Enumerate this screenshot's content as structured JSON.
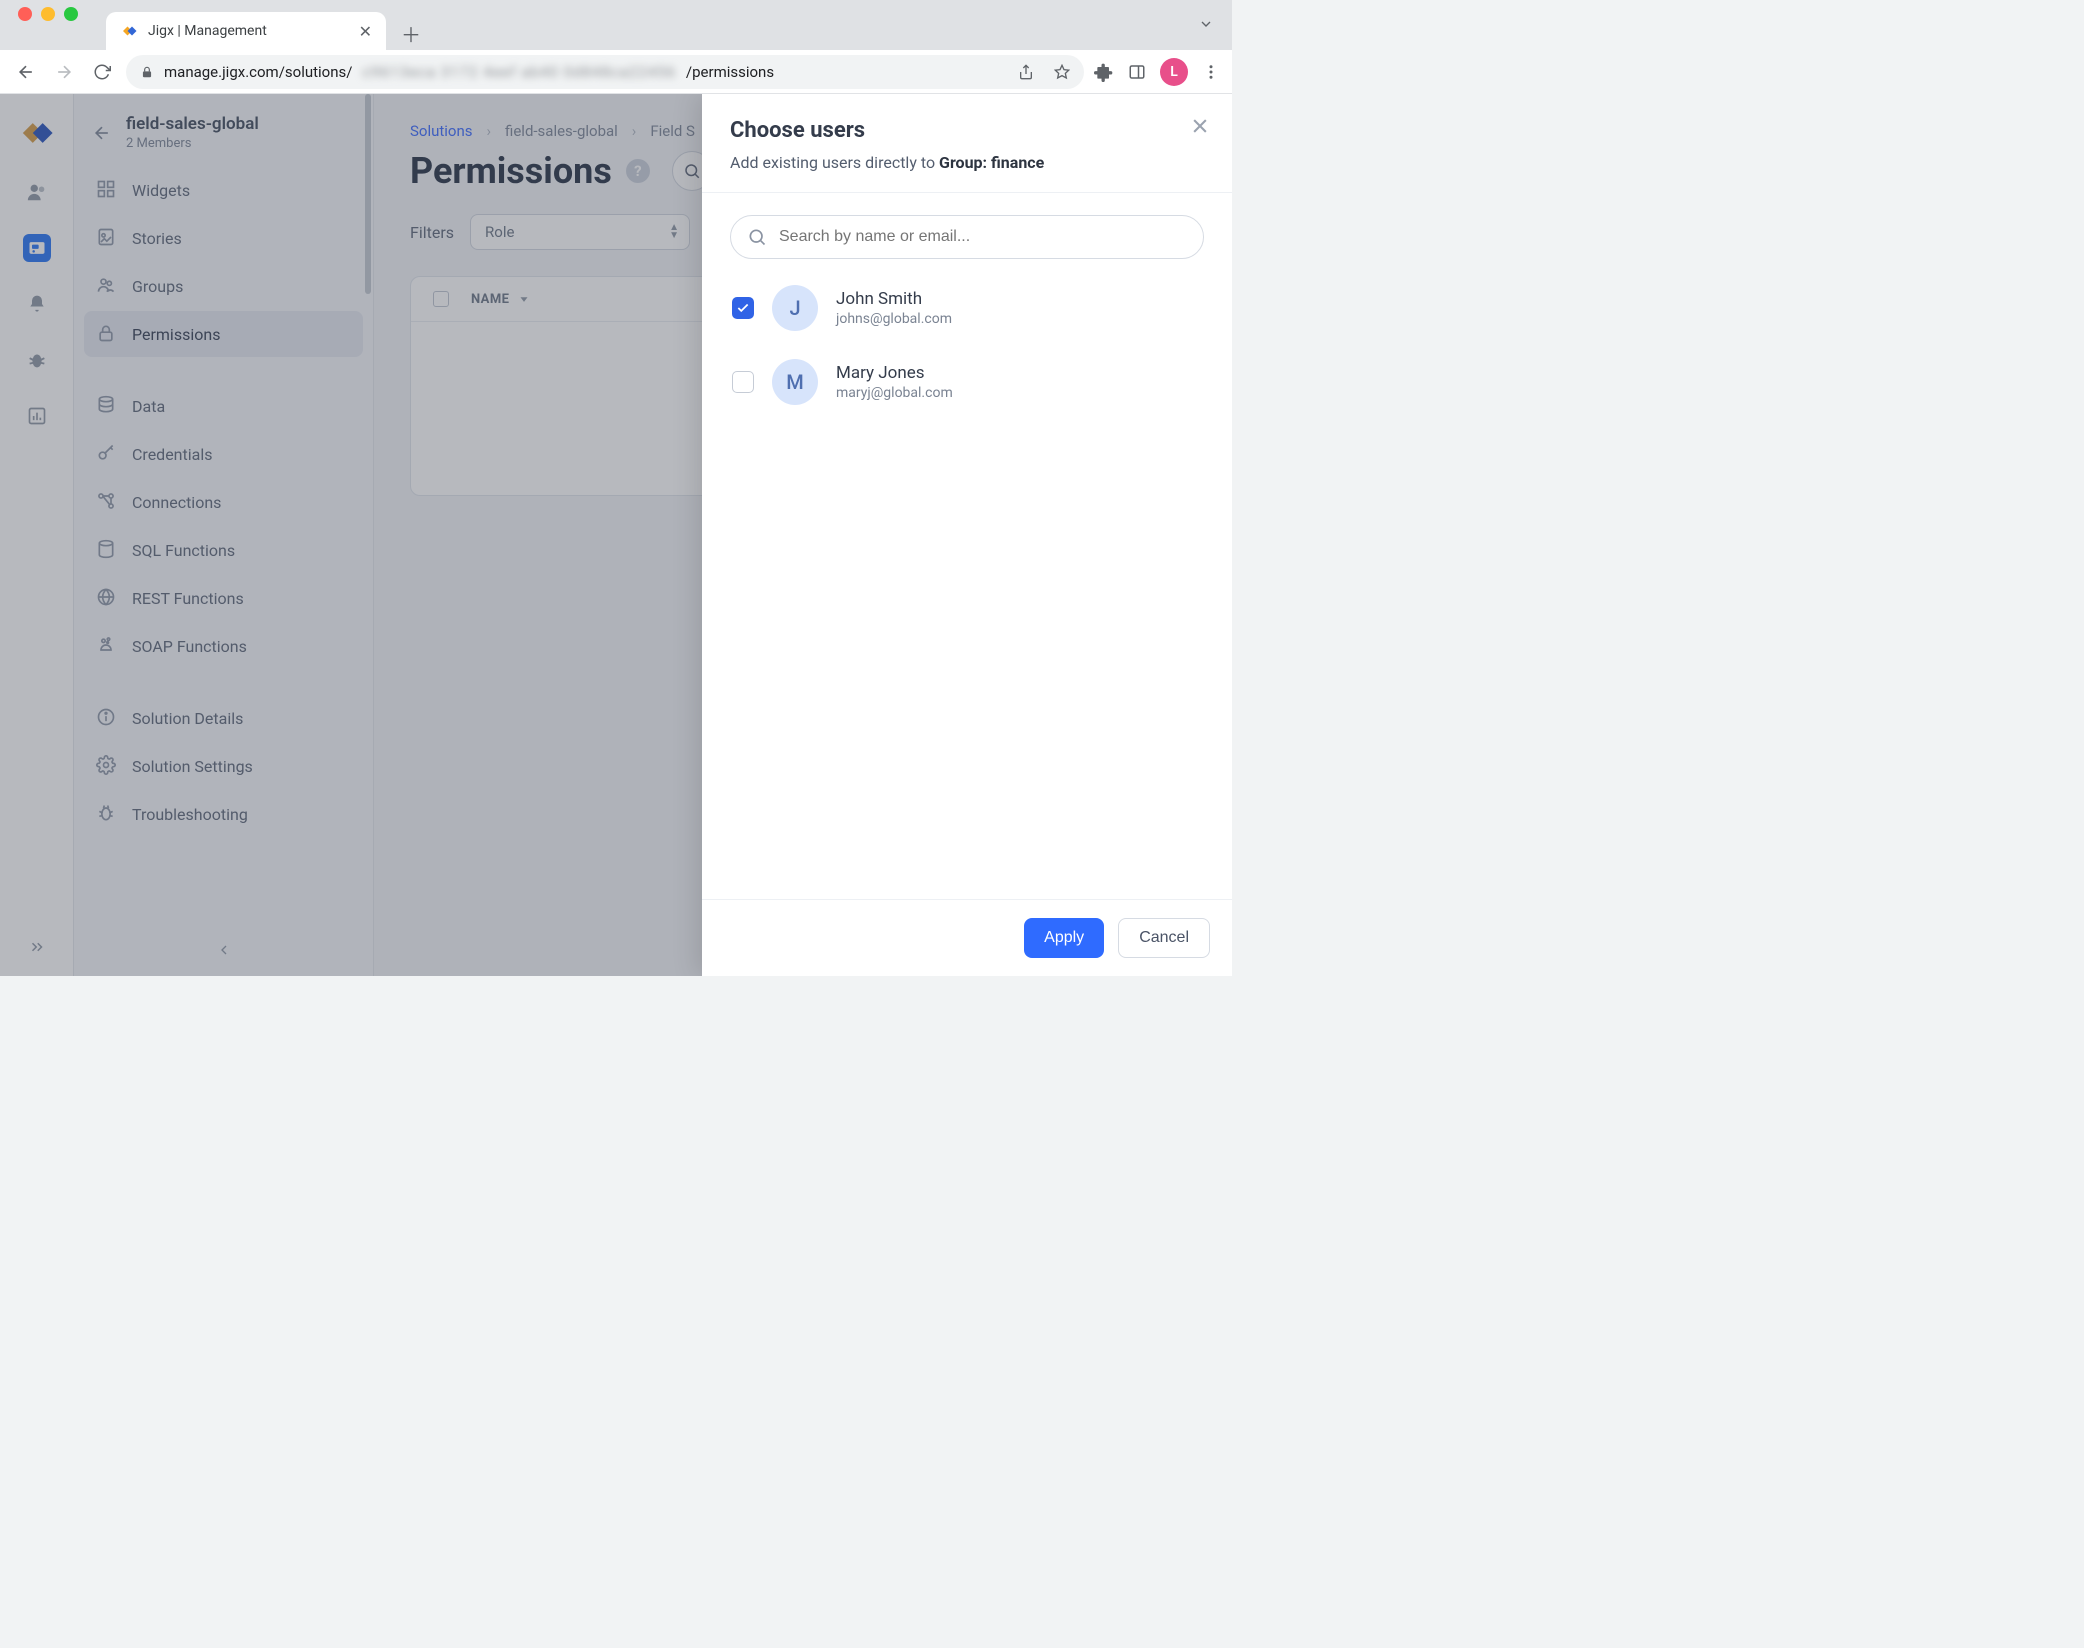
{
  "browser": {
    "tab_title": "Jigx | Management",
    "url_host": "manage.jigx.com/solutions/",
    "url_hidden": "c9613eca 3172 4eef ab40 0d848ca22456",
    "url_tail": "/permissions",
    "avatar_letter": "L"
  },
  "rail": {
    "items": [
      "users",
      "solutions",
      "notifications",
      "bugs",
      "analytics"
    ]
  },
  "project": {
    "name": "field-sales-global",
    "members": "2 Members"
  },
  "sidebar": {
    "items": [
      {
        "label": "Widgets"
      },
      {
        "label": "Stories"
      },
      {
        "label": "Groups"
      },
      {
        "label": "Permissions"
      },
      {
        "label": "Data"
      },
      {
        "label": "Credentials"
      },
      {
        "label": "Connections"
      },
      {
        "label": "SQL Functions"
      },
      {
        "label": "REST Functions"
      },
      {
        "label": "SOAP Functions"
      },
      {
        "label": "Solution Details"
      },
      {
        "label": "Solution Settings"
      },
      {
        "label": "Troubleshooting"
      }
    ]
  },
  "breadcrumbs": {
    "root": "Solutions",
    "proj": "field-sales-global",
    "leaf": "Field S"
  },
  "page": {
    "title": "Permissions",
    "filters_label": "Filters",
    "role_placeholder": "Role",
    "col_name": "NAME"
  },
  "drawer": {
    "title": "Choose users",
    "subtitle_prefix": "Add existing users directly to ",
    "subtitle_group": "Group: finance",
    "search_placeholder": "Search by name or email...",
    "users": [
      {
        "initial": "J",
        "name": "John Smith",
        "email": "johns@global.com",
        "checked": true
      },
      {
        "initial": "M",
        "name": "Mary Jones",
        "email": "maryj@global.com",
        "checked": false
      }
    ],
    "apply": "Apply",
    "cancel": "Cancel"
  }
}
